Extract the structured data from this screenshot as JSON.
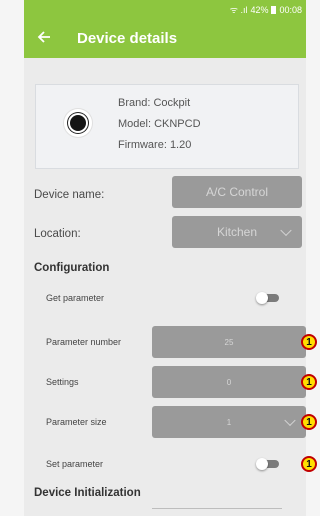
{
  "status": {
    "signal": "ᯤ .ıl",
    "battery": "42%",
    "battery_icon": "battery-icon",
    "time": "00:08"
  },
  "appbar": {
    "title": "Device details"
  },
  "device": {
    "brand": "Brand: Cockpit",
    "model": "Model: CKNPCD",
    "firmware": "Firmware: 1.20"
  },
  "fields": {
    "device_name_label": "Device name:",
    "device_name_value": "A/C Control",
    "location_label": "Location:",
    "location_value": "Kitchen"
  },
  "configuration": {
    "heading": "Configuration",
    "get_parameter_label": "Get parameter",
    "parameter_number_label": "Parameter number",
    "parameter_number_value": "25",
    "settings_label": "Settings",
    "settings_value": "0",
    "parameter_size_label": "Parameter size",
    "parameter_size_value": "1",
    "set_parameter_label": "Set parameter"
  },
  "initialization": {
    "heading": "Device Initialization"
  },
  "badges": [
    "1",
    "1",
    "1",
    "1"
  ],
  "colors": {
    "accent": "#8dc63f",
    "field": "#9a9a9a",
    "badge": "#ffde00",
    "badge_border": "#c10000"
  }
}
